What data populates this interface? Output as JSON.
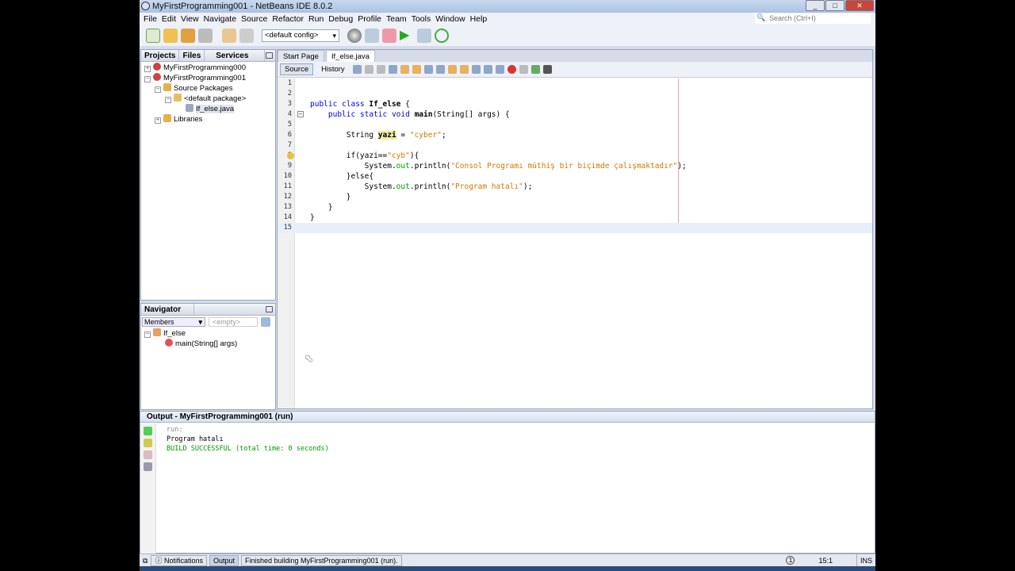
{
  "window": {
    "title": "MyFirstProgramming001 - NetBeans IDE 8.0.2"
  },
  "menu": [
    "File",
    "Edit",
    "View",
    "Navigate",
    "Source",
    "Refactor",
    "Run",
    "Debug",
    "Profile",
    "Team",
    "Tools",
    "Window",
    "Help"
  ],
  "search": {
    "placeholder": "Search (Ctrl+I)"
  },
  "toolbar": {
    "config": "<default config>"
  },
  "projects": {
    "tabs": [
      "Projects",
      "Files",
      "Services"
    ],
    "tree": [
      "MyFirstProgramming000",
      "MyFirstProgramming001",
      "Source Packages",
      "<default package>",
      "If_else.java",
      "Libraries"
    ]
  },
  "navigator": {
    "title": "Navigator",
    "filter": "Members",
    "empty": "<empty>",
    "tree": [
      "If_else",
      "main(String[] args)"
    ]
  },
  "editor": {
    "tabs": [
      "Start Page",
      "If_else.java"
    ],
    "modes": [
      "Source",
      "History"
    ],
    "lines": [
      [],
      [],
      [
        [
          "public class ",
          "kw"
        ],
        [
          "If_else",
          "bold"
        ],
        [
          " {",
          ""
        ]
      ],
      [
        [
          "    public static void ",
          "kw"
        ],
        [
          "main",
          "bold"
        ],
        [
          "(String[] args) {",
          ""
        ]
      ],
      [],
      [
        [
          "        String ",
          ""
        ],
        [
          "yazi",
          "hl bold"
        ],
        [
          " = ",
          ""
        ],
        [
          "\"cyber\"",
          "str"
        ],
        [
          ";",
          ""
        ]
      ],
      [],
      [
        [
          "        if(yazi==",
          ""
        ],
        [
          "\"cyb\"",
          "str"
        ],
        [
          "){",
          ""
        ]
      ],
      [
        [
          "            System.",
          ""
        ],
        [
          "out",
          "fld"
        ],
        [
          ".println(",
          ""
        ],
        [
          "\"Consol Programı müthiş bir biçimde çalışmaktadır\"",
          "str"
        ],
        [
          ");",
          ""
        ]
      ],
      [
        [
          "        }else{",
          ""
        ]
      ],
      [
        [
          "            System.",
          ""
        ],
        [
          "out",
          "fld"
        ],
        [
          ".println(",
          ""
        ],
        [
          "\"Program hatalı\"",
          "str"
        ],
        [
          ");",
          ""
        ]
      ],
      [
        [
          "        }",
          ""
        ]
      ],
      [
        [
          "    }",
          ""
        ]
      ],
      [
        [
          "}",
          ""
        ]
      ],
      []
    ]
  },
  "output": {
    "title": "Output - MyFirstProgramming001 (run)",
    "lines": [
      "run:",
      "Program hatalı",
      "BUILD SUCCESSFUL (total time: 0 seconds)"
    ]
  },
  "status": {
    "notifications": "Notifications",
    "output": "Output",
    "message": "Finished building MyFirstProgramming001 (run).",
    "position": "15:1",
    "mode": "INS",
    "badge": "1"
  }
}
